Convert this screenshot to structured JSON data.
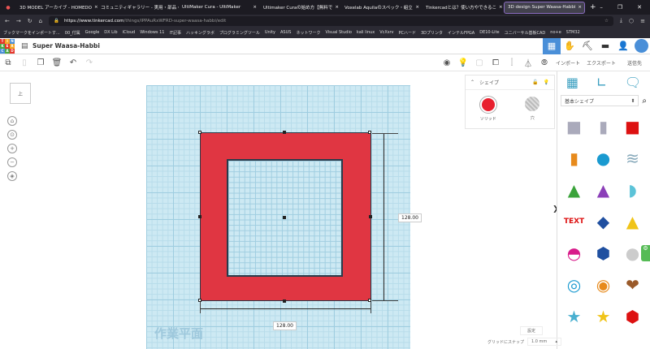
{
  "browser": {
    "tabs": [
      {
        "label": "3D MODEL アーカイブ - HOMEDO"
      },
      {
        "label": "コミュニティギャラリー - 実用・部品・本"
      },
      {
        "label": "UltiMaker Cura - UltiMaker"
      },
      {
        "label": "Ultimaker Curaの始め方【無料で"
      },
      {
        "label": "Voxelab Aquilaのスペック・組立"
      },
      {
        "label": "Tinkercadとは？使い方やできるこ"
      },
      {
        "label": "3D design Super Waasa-Habbi",
        "active": true
      }
    ],
    "url_domain": "https://www.tinkercad.com",
    "url_path": "/things/lPPAuRxWFRD-super-waasa-habbi/edit",
    "bookmarks": [
      "ブックマークをインポートす...",
      "00_付属",
      "Google",
      "DX Lib",
      "iCloud",
      "Windows 11",
      "IT記事",
      "ハッキングラボ",
      "プログラミングツール",
      "Unity",
      "ASUS",
      "ネットワーク",
      "Visual Studio",
      "kali linux",
      "VcXsrv",
      "PCハード",
      "3Dプリンタ",
      "インテルFPGA",
      "DE10-Lite",
      "ユニバーサル基板CAD",
      "no+e",
      "STM32"
    ]
  },
  "app": {
    "logo": [
      "TIN",
      "KER",
      "CAD"
    ],
    "design_title": "Super Waasa-Habbi",
    "import_label": "インポート",
    "export_label": "エクスポート",
    "send_label": "送信先"
  },
  "viewcube": {
    "label": "上"
  },
  "shape_panel": {
    "title": "シェイプ",
    "solid_label": "ソリッド",
    "hole_label": "穴",
    "solid_color": "#e8202e"
  },
  "dimensions": {
    "height": "128.00",
    "width": "128.00"
  },
  "workplane_label": "作業平面",
  "right_panel": {
    "category": "基本シェイプ"
  },
  "settings": {
    "label": "設定",
    "snap_label": "グリッドにスナップ",
    "snap_value": "1.0 mm"
  },
  "colors": {
    "accent": "#4a8fd8",
    "shape": "#e03642",
    "grid": "#cde9f3"
  }
}
